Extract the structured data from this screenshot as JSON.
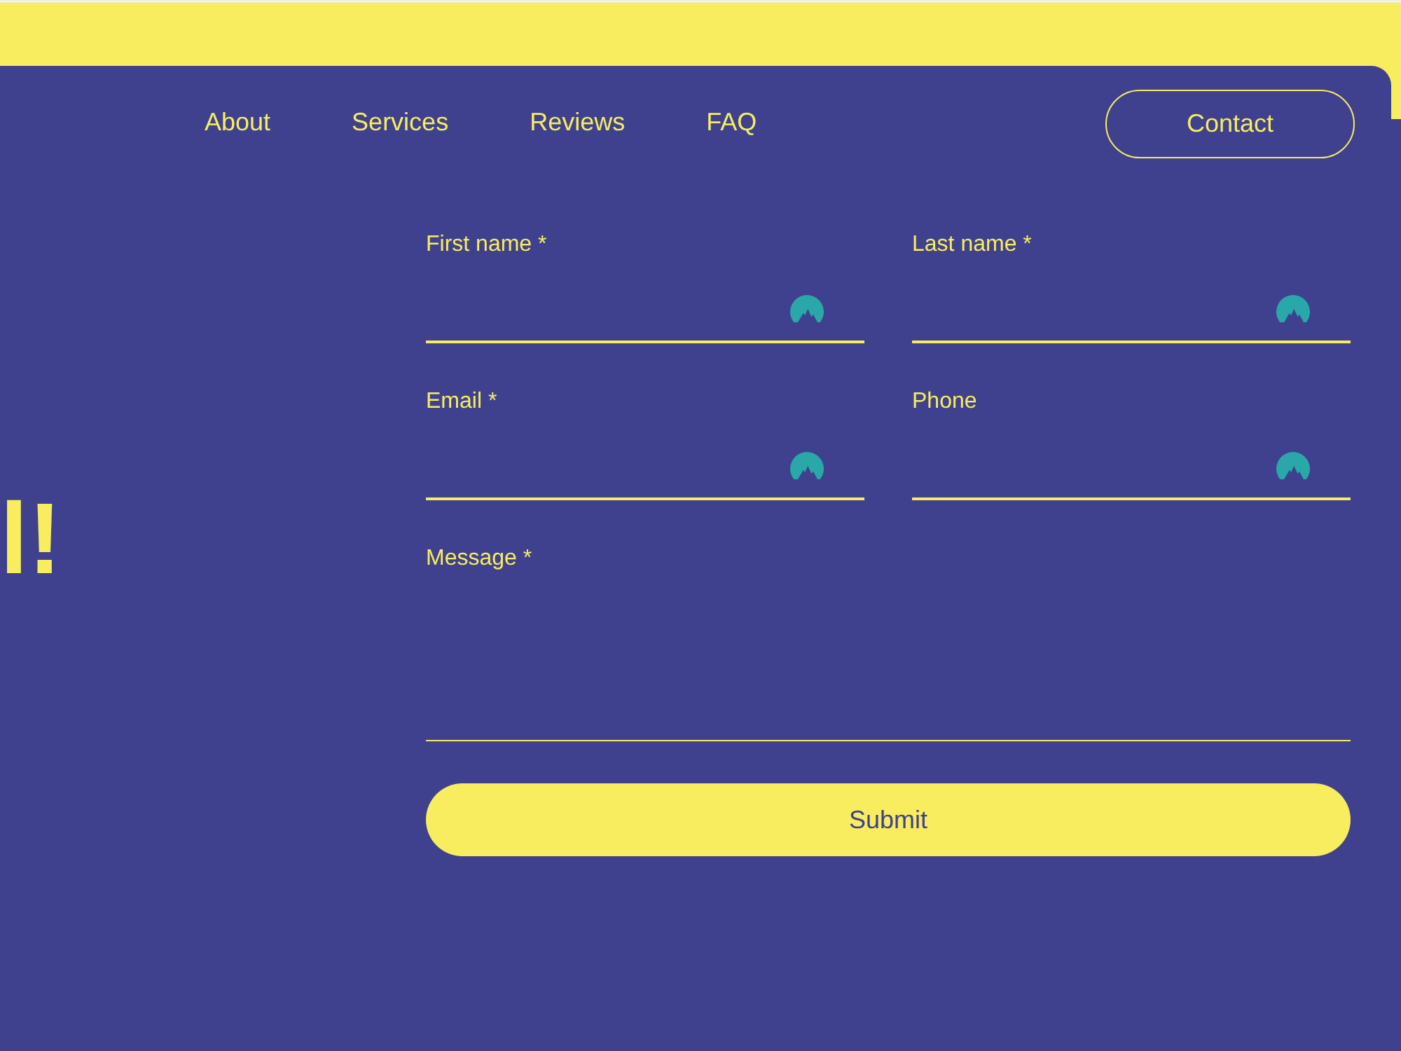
{
  "nav": {
    "links": [
      "About",
      "Services",
      "Reviews",
      "FAQ"
    ],
    "cta": "Contact"
  },
  "hero": {
    "heading": "l!"
  },
  "form": {
    "fields": [
      {
        "label": "First name *",
        "kind": "input"
      },
      {
        "label": "Last name *",
        "kind": "input"
      },
      {
        "label": "Email *",
        "kind": "input"
      },
      {
        "label": "Phone",
        "kind": "input"
      },
      {
        "label": "Message *",
        "kind": "textarea"
      }
    ],
    "submit": "Submit"
  }
}
